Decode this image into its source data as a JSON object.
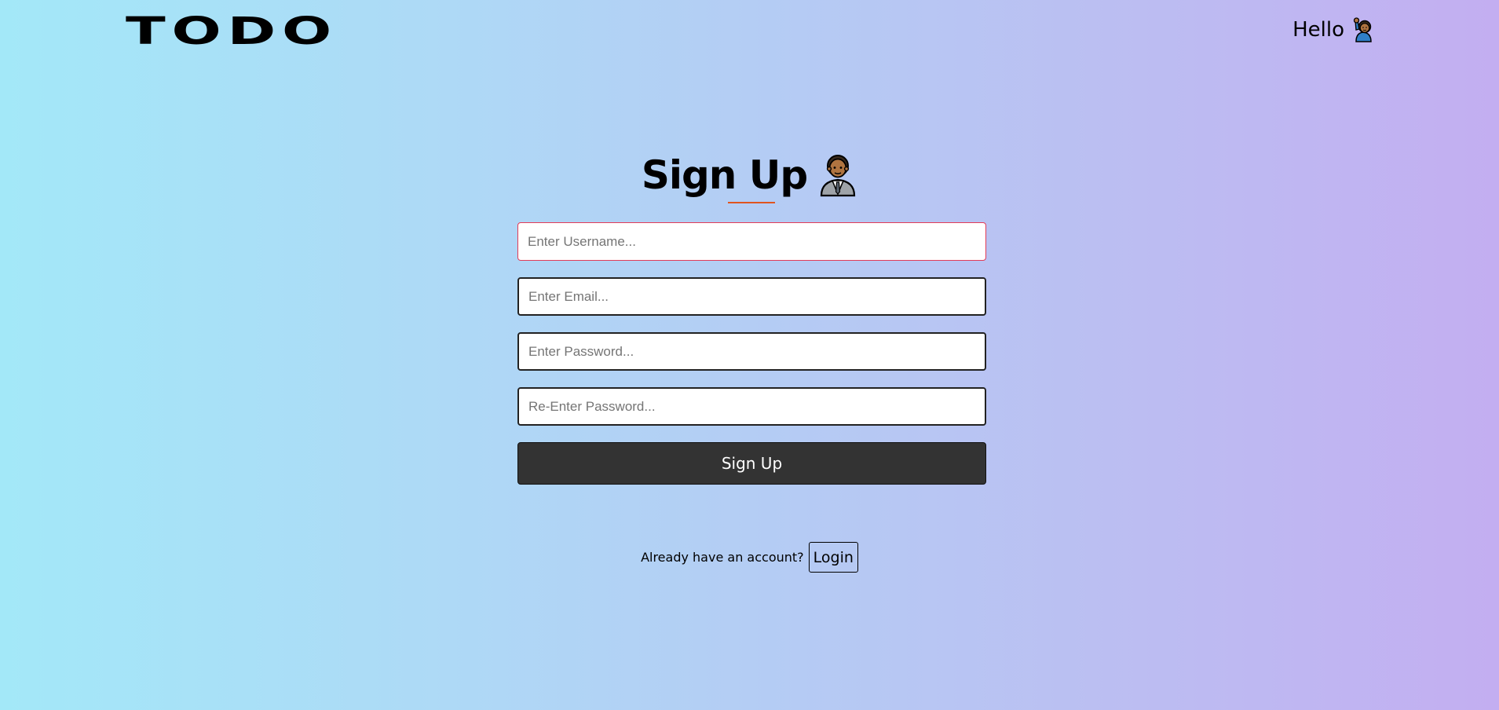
{
  "header": {
    "logo": "TODO",
    "greeting": "Hello",
    "greeting_icon": "raising-hand-icon"
  },
  "signup": {
    "title": "Sign Up",
    "title_icon": "office-worker-icon",
    "username_placeholder": "Enter Username...",
    "email_placeholder": "Enter Email...",
    "password_placeholder": "Enter Password...",
    "reenter_password_placeholder": "Re-Enter Password...",
    "submit_label": "Sign Up"
  },
  "footer": {
    "prompt": "Already have an account?",
    "login_label": "Login"
  },
  "colors": {
    "accent_underline": "#e0541f",
    "active_border": "#e23b57",
    "button_bg": "#333333",
    "gradient_start": "#a3e8f8",
    "gradient_end": "#c3aef1"
  }
}
